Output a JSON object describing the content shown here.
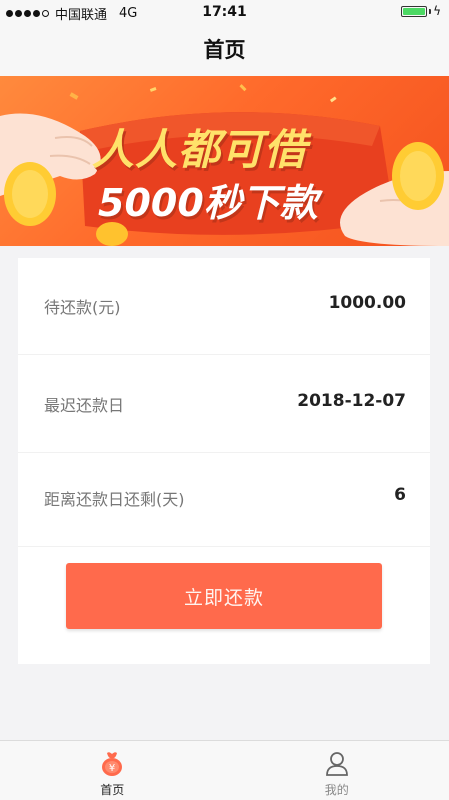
{
  "status_bar": {
    "carrier": "中国联通",
    "network": "4G",
    "time": "17:41",
    "signal_bars_filled": 4,
    "signal_bars_total": 5,
    "battery_level": 1.0,
    "battery_color": "#4cd964"
  },
  "nav": {
    "title": "首页"
  },
  "banner": {
    "line1": "人人都可借",
    "line2": "5000秒下款"
  },
  "details": [
    {
      "label": "待还款(元)",
      "value": "1000.00"
    },
    {
      "label": "最迟还款日",
      "value": "2018-12-07"
    },
    {
      "label": "距离还款日还剩(天)",
      "value": "6"
    }
  ],
  "repay_button": {
    "label": "立即还款",
    "color": "#ff6a4c"
  },
  "tabs": [
    {
      "label": "首页",
      "icon": "home-money-bag-icon",
      "active": true
    },
    {
      "label": "我的",
      "icon": "user-profile-icon",
      "active": false
    }
  ]
}
